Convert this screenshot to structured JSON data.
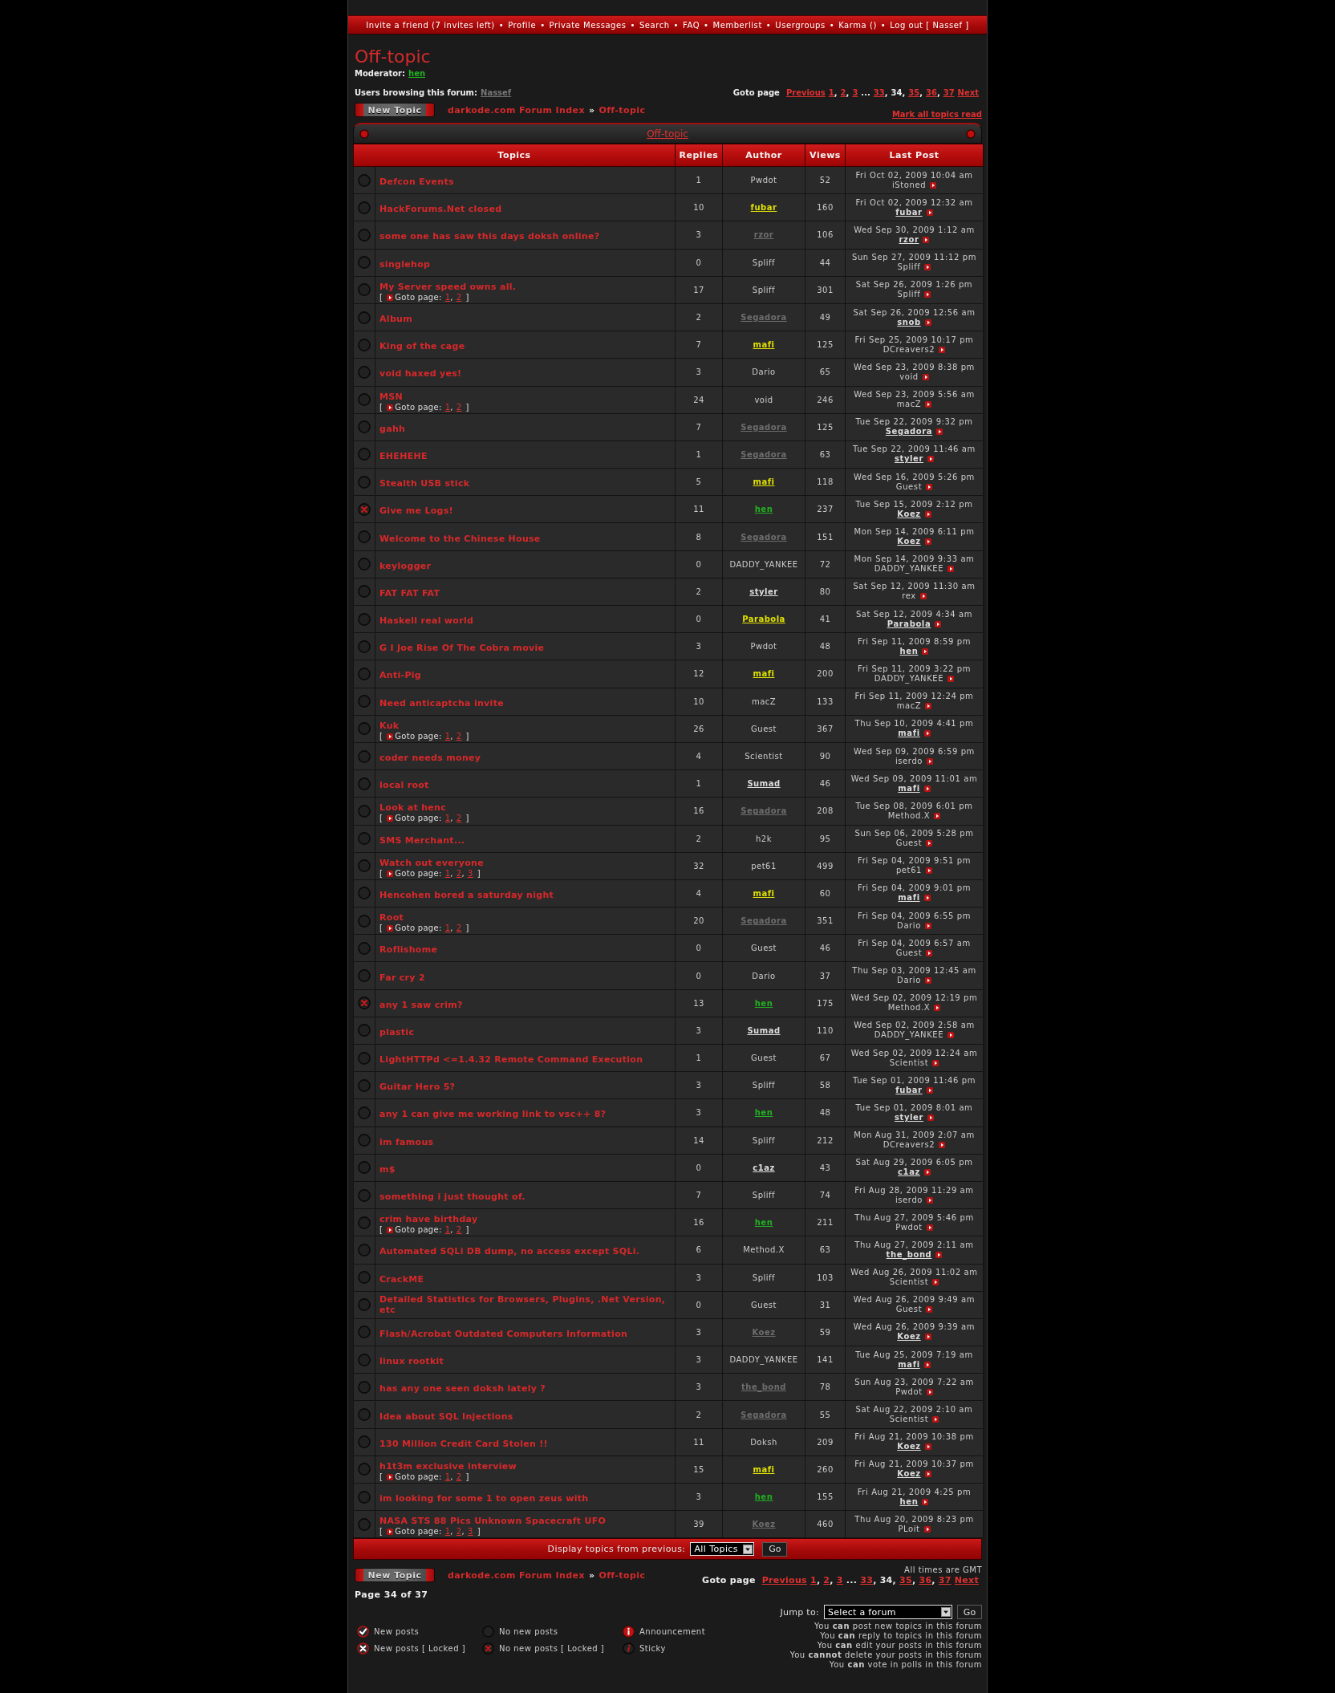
{
  "nav": {
    "separator": "•",
    "links": [
      "Invite a friend (7 invites left)",
      "Profile",
      "Private Messages",
      "Search",
      "FAQ",
      "Memberlist",
      "Usergroups",
      "Karma ()",
      "Log out [ Nassef ]"
    ]
  },
  "forum": {
    "title": "Off-topic",
    "moderator_label": "Moderator:",
    "moderator": "hen",
    "browsing_label": "Users browsing this forum:",
    "browsing_user": "Nassef"
  },
  "pagination_top": {
    "label": "Goto page",
    "items": [
      {
        "kind": "link",
        "text": "Previous"
      },
      {
        "kind": "page",
        "text": "1",
        "selected": false
      },
      {
        "kind": "sep",
        "text": ","
      },
      {
        "kind": "page",
        "text": "2",
        "selected": false
      },
      {
        "kind": "sep",
        "text": ","
      },
      {
        "kind": "page",
        "text": "3",
        "selected": false
      },
      {
        "kind": "gap",
        "text": "..."
      },
      {
        "kind": "page",
        "text": "33",
        "selected": false
      },
      {
        "kind": "sep",
        "text": ","
      },
      {
        "kind": "page",
        "text": "34",
        "selected": true
      },
      {
        "kind": "sep",
        "text": ","
      },
      {
        "kind": "page",
        "text": "35",
        "selected": false
      },
      {
        "kind": "sep",
        "text": ","
      },
      {
        "kind": "page",
        "text": "36",
        "selected": false
      },
      {
        "kind": "sep",
        "text": ","
      },
      {
        "kind": "page",
        "text": "37",
        "selected": false
      },
      {
        "kind": "link",
        "text": "Next"
      }
    ]
  },
  "new_topic_top": "New Topic",
  "breadcrumb_top": {
    "separator": "»",
    "items": [
      "darkode.com Forum Index",
      "Off-topic"
    ]
  },
  "mark_read": "Mark all topics read",
  "table": {
    "title": "Off-topic",
    "columns": [
      "Topics",
      "Replies",
      "Author",
      "Views",
      "Last Post"
    ],
    "rows": [
      {
        "title": "Defcon Events",
        "locked": false,
        "replies": "1",
        "author": {
          "name": "Pwdot",
          "linked": false
        },
        "views": "52",
        "last_post": {
          "date": "Fri Oct 02, 2009 10:04 am",
          "user": "iStoned",
          "linked": false
        }
      },
      {
        "title": "HackForums.Net closed",
        "locked": false,
        "replies": "10",
        "author": {
          "name": "fubar",
          "linked": true,
          "color": "#e0e000"
        },
        "views": "160",
        "last_post": {
          "date": "Fri Oct 02, 2009 12:32 am",
          "user": "fubar",
          "linked": true
        }
      },
      {
        "title": "some one has saw this days doksh online?",
        "locked": false,
        "replies": "3",
        "author": {
          "name": "rzor",
          "linked": true,
          "color": "#6e6e6e"
        },
        "views": "106",
        "last_post": {
          "date": "Wed Sep 30, 2009 1:12 am",
          "user": "rzor",
          "linked": true
        }
      },
      {
        "title": "singlehop",
        "locked": false,
        "replies": "0",
        "author": {
          "name": "Spliff",
          "linked": false
        },
        "views": "44",
        "last_post": {
          "date": "Sun Sep 27, 2009 11:12 pm",
          "user": "Spliff",
          "linked": false
        }
      },
      {
        "title": "My Server speed owns all.",
        "locked": false,
        "goto": {
          "open": "[",
          "label": "Goto page:",
          "pages": [
            "1",
            "2"
          ],
          "separator": ",",
          "close": "]"
        },
        "replies": "17",
        "author": {
          "name": "Spliff",
          "linked": false
        },
        "views": "301",
        "last_post": {
          "date": "Sat Sep 26, 2009 1:26 pm",
          "user": "Spliff",
          "linked": false
        }
      },
      {
        "title": "Album",
        "locked": false,
        "replies": "2",
        "author": {
          "name": "Segadora",
          "linked": true,
          "color": "#6e6e6e"
        },
        "views": "49",
        "last_post": {
          "date": "Sat Sep 26, 2009 12:56 am",
          "user": "snob",
          "linked": true
        }
      },
      {
        "title": "King of the cage",
        "locked": false,
        "replies": "7",
        "author": {
          "name": "mafi",
          "linked": true,
          "color": "#e0e000"
        },
        "views": "125",
        "last_post": {
          "date": "Fri Sep 25, 2009 10:17 pm",
          "user": "DCreavers2",
          "linked": false
        }
      },
      {
        "title": "void haxed yes!",
        "locked": false,
        "replies": "3",
        "author": {
          "name": "Dario",
          "linked": false
        },
        "views": "65",
        "last_post": {
          "date": "Wed Sep 23, 2009 8:38 pm",
          "user": "void",
          "linked": false
        }
      },
      {
        "title": "MSN",
        "locked": false,
        "goto": {
          "open": "[",
          "label": "Goto page:",
          "pages": [
            "1",
            "2"
          ],
          "separator": ",",
          "close": "]"
        },
        "replies": "24",
        "author": {
          "name": "void",
          "linked": false
        },
        "views": "246",
        "last_post": {
          "date": "Wed Sep 23, 2009 5:56 am",
          "user": "macZ",
          "linked": false
        }
      },
      {
        "title": "gahh",
        "locked": false,
        "replies": "7",
        "author": {
          "name": "Segadora",
          "linked": true,
          "color": "#6e6e6e"
        },
        "views": "125",
        "last_post": {
          "date": "Tue Sep 22, 2009 9:32 pm",
          "user": "Segadora",
          "linked": true
        }
      },
      {
        "title": "EHEHEHE",
        "locked": false,
        "replies": "1",
        "author": {
          "name": "Segadora",
          "linked": true,
          "color": "#6e6e6e"
        },
        "views": "63",
        "last_post": {
          "date": "Tue Sep 22, 2009 11:46 am",
          "user": "styler",
          "linked": true
        }
      },
      {
        "title": "Stealth USB stick",
        "locked": false,
        "replies": "5",
        "author": {
          "name": "mafi",
          "linked": true,
          "color": "#e0e000"
        },
        "views": "118",
        "last_post": {
          "date": "Wed Sep 16, 2009 5:26 pm",
          "user": "Guest",
          "linked": false
        }
      },
      {
        "title": "Give me Logs!",
        "locked": true,
        "replies": "11",
        "author": {
          "name": "hen",
          "linked": true,
          "color": "#22b022"
        },
        "views": "237",
        "last_post": {
          "date": "Tue Sep 15, 2009 2:12 pm",
          "user": "Koez",
          "linked": true
        }
      },
      {
        "title": "Welcome to the Chinese House",
        "locked": false,
        "replies": "8",
        "author": {
          "name": "Segadora",
          "linked": true,
          "color": "#6e6e6e"
        },
        "views": "151",
        "last_post": {
          "date": "Mon Sep 14, 2009 6:11 pm",
          "user": "Koez",
          "linked": true
        }
      },
      {
        "title": "keylogger",
        "locked": false,
        "replies": "0",
        "author": {
          "name": "DADDY_YANKEE",
          "linked": false
        },
        "views": "72",
        "last_post": {
          "date": "Mon Sep 14, 2009 9:33 am",
          "user": "DADDY_YANKEE",
          "linked": false
        }
      },
      {
        "title": "FAT FAT FAT",
        "locked": false,
        "replies": "2",
        "author": {
          "name": "styler",
          "linked": true,
          "color": "#dddddd"
        },
        "views": "80",
        "last_post": {
          "date": "Sat Sep 12, 2009 11:30 am",
          "user": "rex",
          "linked": false
        }
      },
      {
        "title": "Haskell real world",
        "locked": false,
        "replies": "0",
        "author": {
          "name": "Parabola",
          "linked": true,
          "color": "#e0e000"
        },
        "views": "41",
        "last_post": {
          "date": "Sat Sep 12, 2009 4:34 am",
          "user": "Parabola",
          "linked": true
        }
      },
      {
        "title": "G I Joe Rise Of The Cobra movie",
        "locked": false,
        "replies": "3",
        "author": {
          "name": "Pwdot",
          "linked": false
        },
        "views": "48",
        "last_post": {
          "date": "Fri Sep 11, 2009 8:59 pm",
          "user": "hen",
          "linked": true
        }
      },
      {
        "title": "Anti-Pig",
        "locked": false,
        "replies": "12",
        "author": {
          "name": "mafi",
          "linked": true,
          "color": "#e0e000"
        },
        "views": "200",
        "last_post": {
          "date": "Fri Sep 11, 2009 3:22 pm",
          "user": "DADDY_YANKEE",
          "linked": false
        }
      },
      {
        "title": "Need anticaptcha invite",
        "locked": false,
        "replies": "10",
        "author": {
          "name": "macZ",
          "linked": false
        },
        "views": "133",
        "last_post": {
          "date": "Fri Sep 11, 2009 12:24 pm",
          "user": "macZ",
          "linked": false
        }
      },
      {
        "title": "Kuk",
        "locked": false,
        "goto": {
          "open": "[",
          "label": "Goto page:",
          "pages": [
            "1",
            "2"
          ],
          "separator": ",",
          "close": "]"
        },
        "replies": "26",
        "author": {
          "name": "Guest",
          "linked": false
        },
        "views": "367",
        "last_post": {
          "date": "Thu Sep 10, 2009 4:41 pm",
          "user": "mafi",
          "linked": true
        }
      },
      {
        "title": "coder needs money",
        "locked": false,
        "replies": "4",
        "author": {
          "name": "Scientist",
          "linked": false
        },
        "views": "90",
        "last_post": {
          "date": "Wed Sep 09, 2009 6:59 pm",
          "user": "iserdo",
          "linked": false
        }
      },
      {
        "title": "local root",
        "locked": false,
        "replies": "1",
        "author": {
          "name": "Sumad",
          "linked": true,
          "color": "#dddddd"
        },
        "views": "46",
        "last_post": {
          "date": "Wed Sep 09, 2009 11:01 am",
          "user": "mafi",
          "linked": true
        }
      },
      {
        "title": "Look at henc",
        "locked": false,
        "goto": {
          "open": "[",
          "label": "Goto page:",
          "pages": [
            "1",
            "2"
          ],
          "separator": ",",
          "close": "]"
        },
        "replies": "16",
        "author": {
          "name": "Segadora",
          "linked": true,
          "color": "#6e6e6e"
        },
        "views": "208",
        "last_post": {
          "date": "Tue Sep 08, 2009 6:01 pm",
          "user": "Method.X",
          "linked": false
        }
      },
      {
        "title": "SMS Merchant...",
        "locked": false,
        "replies": "2",
        "author": {
          "name": "h2k",
          "linked": false
        },
        "views": "95",
        "last_post": {
          "date": "Sun Sep 06, 2009 5:28 pm",
          "user": "Guest",
          "linked": false
        }
      },
      {
        "title": "Watch out everyone",
        "locked": false,
        "goto": {
          "open": "[",
          "label": "Goto page:",
          "pages": [
            "1",
            "2",
            "3"
          ],
          "separator": ",",
          "close": "]"
        },
        "replies": "32",
        "author": {
          "name": "pet61",
          "linked": false
        },
        "views": "499",
        "last_post": {
          "date": "Fri Sep 04, 2009 9:51 pm",
          "user": "pet61",
          "linked": false
        }
      },
      {
        "title": "Hencohen bored a saturday night",
        "locked": false,
        "replies": "4",
        "author": {
          "name": "mafi",
          "linked": true,
          "color": "#e0e000"
        },
        "views": "60",
        "last_post": {
          "date": "Fri Sep 04, 2009 9:01 pm",
          "user": "mafi",
          "linked": true
        }
      },
      {
        "title": "Root",
        "locked": false,
        "goto": {
          "open": "[",
          "label": "Goto page:",
          "pages": [
            "1",
            "2"
          ],
          "separator": ",",
          "close": "]"
        },
        "replies": "20",
        "author": {
          "name": "Segadora",
          "linked": true,
          "color": "#6e6e6e"
        },
        "views": "351",
        "last_post": {
          "date": "Fri Sep 04, 2009 6:55 pm",
          "user": "Dario",
          "linked": false
        }
      },
      {
        "title": "Roflishome",
        "locked": false,
        "replies": "0",
        "author": {
          "name": "Guest",
          "linked": false
        },
        "views": "46",
        "last_post": {
          "date": "Fri Sep 04, 2009 6:57 am",
          "user": "Guest",
          "linked": false
        }
      },
      {
        "title": "Far cry 2",
        "locked": false,
        "replies": "0",
        "author": {
          "name": "Dario",
          "linked": false
        },
        "views": "37",
        "last_post": {
          "date": "Thu Sep 03, 2009 12:45 am",
          "user": "Dario",
          "linked": false
        }
      },
      {
        "title": "any 1 saw crim?",
        "locked": true,
        "replies": "13",
        "author": {
          "name": "hen",
          "linked": true,
          "color": "#22b022"
        },
        "views": "175",
        "last_post": {
          "date": "Wed Sep 02, 2009 12:19 pm",
          "user": "Method.X",
          "linked": false
        }
      },
      {
        "title": "plastic",
        "locked": false,
        "replies": "3",
        "author": {
          "name": "Sumad",
          "linked": true,
          "color": "#dddddd"
        },
        "views": "110",
        "last_post": {
          "date": "Wed Sep 02, 2009 2:58 am",
          "user": "DADDY_YANKEE",
          "linked": false
        }
      },
      {
        "title": "LightHTTPd <=1.4.32 Remote Command Execution",
        "locked": false,
        "replies": "1",
        "author": {
          "name": "Guest",
          "linked": false
        },
        "views": "67",
        "last_post": {
          "date": "Wed Sep 02, 2009 12:24 am",
          "user": "Scientist",
          "linked": false
        }
      },
      {
        "title": "Guitar Hero 5?",
        "locked": false,
        "replies": "3",
        "author": {
          "name": "Spliff",
          "linked": false
        },
        "views": "58",
        "last_post": {
          "date": "Tue Sep 01, 2009 11:46 pm",
          "user": "fubar",
          "linked": true
        }
      },
      {
        "title": "any 1 can give me working link to vsc++ 8?",
        "locked": false,
        "replies": "3",
        "author": {
          "name": "hen",
          "linked": true,
          "color": "#22b022"
        },
        "views": "48",
        "last_post": {
          "date": "Tue Sep 01, 2009 8:01 am",
          "user": "styler",
          "linked": true
        }
      },
      {
        "title": "im famous",
        "locked": false,
        "replies": "14",
        "author": {
          "name": "Spliff",
          "linked": false
        },
        "views": "212",
        "last_post": {
          "date": "Mon Aug 31, 2009 2:07 am",
          "user": "DCreavers2",
          "linked": false
        }
      },
      {
        "title": "m$",
        "locked": false,
        "replies": "0",
        "author": {
          "name": "c1az",
          "linked": true,
          "color": "#dddddd"
        },
        "views": "43",
        "last_post": {
          "date": "Sat Aug 29, 2009 6:05 pm",
          "user": "c1az",
          "linked": true
        }
      },
      {
        "title": "something i just thought of.",
        "locked": false,
        "replies": "7",
        "author": {
          "name": "Spliff",
          "linked": false
        },
        "views": "74",
        "last_post": {
          "date": "Fri Aug 28, 2009 11:29 am",
          "user": "iserdo",
          "linked": false
        }
      },
      {
        "title": "crim have birthday",
        "locked": false,
        "goto": {
          "open": "[",
          "label": "Goto page:",
          "pages": [
            "1",
            "2"
          ],
          "separator": ",",
          "close": "]"
        },
        "replies": "16",
        "author": {
          "name": "hen",
          "linked": true,
          "color": "#22b022"
        },
        "views": "211",
        "last_post": {
          "date": "Thu Aug 27, 2009 5:46 pm",
          "user": "Pwdot",
          "linked": false
        }
      },
      {
        "title": "Automated SQLi DB dump, no access except SQLi.",
        "locked": false,
        "replies": "6",
        "author": {
          "name": "Method.X",
          "linked": false
        },
        "views": "63",
        "last_post": {
          "date": "Thu Aug 27, 2009 2:11 am",
          "user": "the_bond",
          "linked": true
        }
      },
      {
        "title": "CrackME",
        "locked": false,
        "replies": "3",
        "author": {
          "name": "Spliff",
          "linked": false
        },
        "views": "103",
        "last_post": {
          "date": "Wed Aug 26, 2009 11:02 am",
          "user": "Scientist",
          "linked": false
        }
      },
      {
        "title": "Detailed Statistics for Browsers, Plugins, .Net Version, etc",
        "locked": false,
        "replies": "0",
        "author": {
          "name": "Guest",
          "linked": false
        },
        "views": "31",
        "last_post": {
          "date": "Wed Aug 26, 2009 9:49 am",
          "user": "Guest",
          "linked": false
        }
      },
      {
        "title": "Flash/Acrobat Outdated Computers Information",
        "locked": false,
        "replies": "3",
        "author": {
          "name": "Koez",
          "linked": true,
          "color": "#6e6e6e"
        },
        "views": "59",
        "last_post": {
          "date": "Wed Aug 26, 2009 9:39 am",
          "user": "Koez",
          "linked": true
        }
      },
      {
        "title": "linux rootkit",
        "locked": false,
        "replies": "3",
        "author": {
          "name": "DADDY_YANKEE",
          "linked": false
        },
        "views": "141",
        "last_post": {
          "date": "Tue Aug 25, 2009 7:19 am",
          "user": "mafi",
          "linked": true
        }
      },
      {
        "title": "has any one seen doksh lately ?",
        "locked": false,
        "replies": "3",
        "author": {
          "name": "the_bond",
          "linked": true,
          "color": "#6e6e6e"
        },
        "views": "78",
        "last_post": {
          "date": "Sun Aug 23, 2009 7:22 am",
          "user": "Pwdot",
          "linked": false
        }
      },
      {
        "title": "Idea about SQL Injections",
        "locked": false,
        "replies": "2",
        "author": {
          "name": "Segadora",
          "linked": true,
          "color": "#6e6e6e"
        },
        "views": "55",
        "last_post": {
          "date": "Sat Aug 22, 2009 2:10 am",
          "user": "Scientist",
          "linked": false
        }
      },
      {
        "title": "130 Million Credit Card Stolen !!",
        "locked": false,
        "replies": "11",
        "author": {
          "name": "Doksh",
          "linked": false
        },
        "views": "209",
        "last_post": {
          "date": "Fri Aug 21, 2009 10:38 pm",
          "user": "Koez",
          "linked": true
        }
      },
      {
        "title": "h1t3m exclusive interview",
        "locked": false,
        "goto": {
          "open": "[",
          "label": "Goto page:",
          "pages": [
            "1",
            "2"
          ],
          "separator": ",",
          "close": "]"
        },
        "replies": "15",
        "author": {
          "name": "mafi",
          "linked": true,
          "color": "#e0e000"
        },
        "views": "260",
        "last_post": {
          "date": "Fri Aug 21, 2009 10:37 pm",
          "user": "Koez",
          "linked": true
        }
      },
      {
        "title": "im looking for some 1 to open zeus with",
        "locked": false,
        "replies": "3",
        "author": {
          "name": "hen",
          "linked": true,
          "color": "#22b022"
        },
        "views": "155",
        "last_post": {
          "date": "Fri Aug 21, 2009 4:25 pm",
          "user": "hen",
          "linked": true
        }
      },
      {
        "title": "NASA STS 88 Pics Unknown Spacecraft UFO",
        "locked": false,
        "goto": {
          "open": "[",
          "label": "Goto page:",
          "pages": [
            "1",
            "2",
            "3"
          ],
          "separator": ",",
          "close": "]"
        },
        "replies": "39",
        "author": {
          "name": "Koez",
          "linked": true,
          "color": "#6e6e6e"
        },
        "views": "460",
        "last_post": {
          "date": "Thu Aug 20, 2009 8:23 pm",
          "user": "PLoit",
          "linked": false
        }
      }
    ]
  },
  "filter_bar": {
    "label": "Display topics from previous:",
    "select": "All Topics",
    "button": "Go"
  },
  "footer": {
    "new_topic": "New Topic",
    "breadcrumb": {
      "separator": "»",
      "items": [
        "darkode.com Forum Index",
        "Off-topic"
      ]
    },
    "timezone": "All times are GMT",
    "pagination": {
      "label": "Goto page",
      "items": [
        {
          "kind": "link",
          "text": "Previous"
        },
        {
          "kind": "page",
          "text": "1",
          "selected": false
        },
        {
          "kind": "sep",
          "text": ","
        },
        {
          "kind": "page",
          "text": "2",
          "selected": false
        },
        {
          "kind": "sep",
          "text": ","
        },
        {
          "kind": "page",
          "text": "3",
          "selected": false
        },
        {
          "kind": "gap",
          "text": "..."
        },
        {
          "kind": "page",
          "text": "33",
          "selected": false
        },
        {
          "kind": "sep",
          "text": ","
        },
        {
          "kind": "page",
          "text": "34",
          "selected": true
        },
        {
          "kind": "sep",
          "text": ","
        },
        {
          "kind": "page",
          "text": "35",
          "selected": false
        },
        {
          "kind": "sep",
          "text": ","
        },
        {
          "kind": "page",
          "text": "36",
          "selected": false
        },
        {
          "kind": "sep",
          "text": ","
        },
        {
          "kind": "page",
          "text": "37",
          "selected": false
        },
        {
          "kind": "link",
          "text": "Next"
        }
      ]
    },
    "page_info": "Page 34 of 37",
    "jump": {
      "label": "Jump to:",
      "select": "Select a forum",
      "button": "Go"
    },
    "legend": [
      {
        "kind": "new",
        "label": "New posts"
      },
      {
        "kind": "none",
        "label": "No new posts"
      },
      {
        "kind": "announce",
        "label": "Announcement"
      },
      {
        "kind": "new-locked",
        "label": "New posts [ Locked ]"
      },
      {
        "kind": "none-locked",
        "label": "No new posts [ Locked ]"
      },
      {
        "kind": "sticky",
        "label": "Sticky"
      }
    ],
    "permissions": [
      "You **can** post new topics in this forum",
      "You **can** reply to topics in this forum",
      "You **can** edit your posts in this forum",
      "You **cannot** delete your posts in this forum",
      "You **can** vote in polls in this forum"
    ]
  }
}
